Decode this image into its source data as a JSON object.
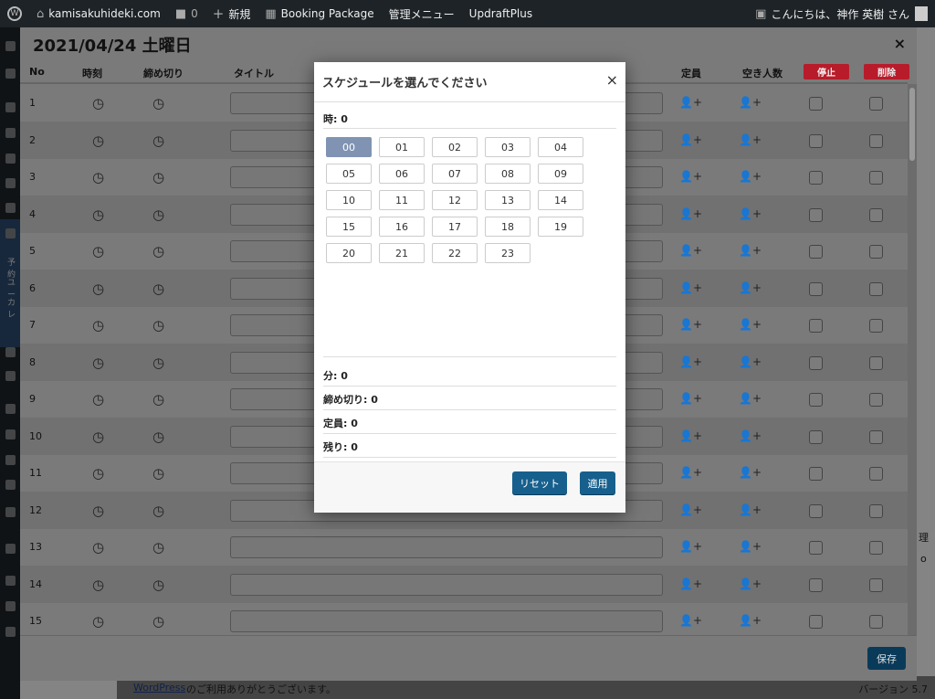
{
  "adminbar": {
    "site_name": "kamisakuhideki.com",
    "comments_count": "0",
    "new_label": "新規",
    "booking_package": "Booking Package",
    "admin_menu": "管理メニュー",
    "updraft": "UpdraftPlus",
    "greeting": "こんにちは、神作 英樹 さん"
  },
  "sidebar": {
    "text1": "予約",
    "text2": "ユー",
    "text3": "カレ"
  },
  "background": {
    "footer_wp": "WordPress",
    "footer_thanks": "のご利用ありがとうございます。",
    "footer_version": "バージョン 5.7",
    "peek1": "理",
    "peek2": "o"
  },
  "panel": {
    "title": "2021/04/24 土曜日",
    "close": "×",
    "columns": {
      "no": "No",
      "time": "時刻",
      "deadline": "締め切り",
      "title": "タイトル",
      "capacity": "定員",
      "remaining": "空き人数",
      "stop": "停止",
      "delete": "削除"
    },
    "rows": [
      "1",
      "2",
      "3",
      "4",
      "5",
      "6",
      "7",
      "8",
      "9",
      "10",
      "11",
      "12",
      "13",
      "14",
      "15"
    ],
    "save": "保存"
  },
  "modal": {
    "title": "スケジュールを選んでください",
    "close": "×",
    "hour_label": "時: 0",
    "hours": [
      "00",
      "01",
      "02",
      "03",
      "04",
      "05",
      "06",
      "07",
      "08",
      "09",
      "10",
      "11",
      "12",
      "13",
      "14",
      "15",
      "16",
      "17",
      "18",
      "19",
      "20",
      "21",
      "22",
      "23"
    ],
    "selected_hour": "00",
    "minute_label": "分: 0",
    "deadline_label": "締め切り: 0",
    "capacity_label": "定員: 0",
    "remaining_label": "残り: 0",
    "reset": "リセット",
    "apply": "適用"
  }
}
